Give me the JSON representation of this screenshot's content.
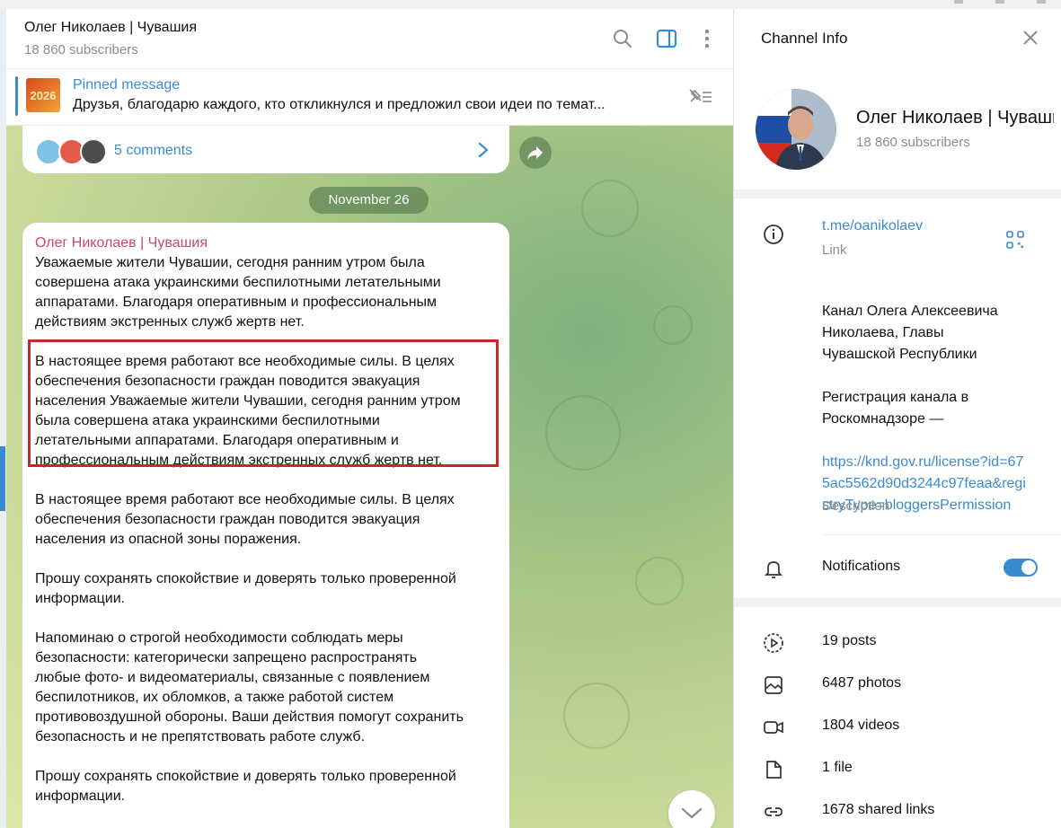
{
  "chat": {
    "title": "Олег Николаев | Чувашия",
    "subscribers": "18 860 subscribers",
    "header_icons": [
      "search-icon",
      "sidebar-toggle-icon",
      "more-vertical-icon"
    ]
  },
  "pinned": {
    "label": "Pinned message",
    "thumb_text": "2026",
    "text": "Друзья, благодарю каждого, кто откликнулся и предложил свои идеи по темат..."
  },
  "comments": {
    "label": "5 comments"
  },
  "date_separator": "November 26",
  "message": {
    "author": "Олег Николаев | Чувашия",
    "paragraphs": [
      "Уважаемые жители Чувашии, сегодня ранним утром была\nсовершена атака украинскими беспилотными летательными\nаппаратами. Благодаря оперативным и профессиональным\nдействиям экстренных служб жертв нет.",
      "В настоящее время работают все необходимые силы. В целях\nобеспечения безопасности граждан поводится эвакуация\nнаселения Уважаемые жители Чувашии, сегодня ранним утром\nбыла совершена атака украинскими беспилотными\nлетательными аппаратами. Благодаря оперативным и\nпрофессиональным действиям экстренных служб жертв нет.",
      "В настоящее время работают все необходимые силы. В целях\nобеспечения безопасности граждан поводится эвакуация\nнаселения из опасной зоны поражения.",
      "Прошу сохранять спокойствие и доверять только проверенной\nинформации.",
      "Напоминаю о строгой необходимости соблюдать меры\nбезопасности: категорически запрещено распространять\nлюбые фото- и видеоматериалы, связанные с появлением\nбеспилотников, их обломков, а также работой систем\nпротивовоздушной обороны. Ваши действия помогут сохранить\nбезопасность и не препятствовать работе служб.",
      "Прошу сохранять спокойствие и доверять только проверенной\nинформации."
    ]
  },
  "info_panel": {
    "title": "Channel Info",
    "name": "Олег Николаев | Чувашия",
    "subscribers": "18 860 subscribers",
    "link": "t.me/oanikolaev",
    "link_label": "Link",
    "description": "Канал Олега Алексеевича\nНиколаева, Главы\nЧувашской Республики\n\nРегистрация канала в\nРоскомнадзоре —",
    "description_url": "https://knd.gov.ru/license?id=675ac5562d90d3244c97feaa&registryType=bloggersPermission",
    "description_label": "Description",
    "notifications_label": "Notifications",
    "notifications_on": true,
    "media": [
      {
        "icon": "posts-icon",
        "label": "19 posts"
      },
      {
        "icon": "photo-icon",
        "label": "6487 photos"
      },
      {
        "icon": "video-icon",
        "label": "1804 videos"
      },
      {
        "icon": "file-icon",
        "label": "1 file"
      },
      {
        "icon": "link-icon",
        "label": "1678 shared links"
      }
    ]
  },
  "colors": {
    "accent": "#3a8bd1",
    "author": "#c84a6d",
    "highlight": "#c52a2a"
  }
}
